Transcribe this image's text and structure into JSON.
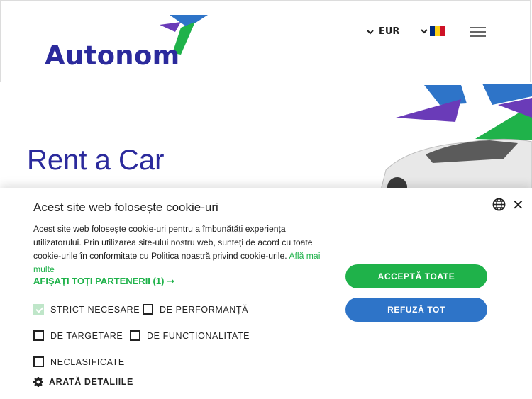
{
  "header": {
    "logo_text": "Autonom",
    "currency": "EUR",
    "flag_colors": [
      "#002b7f",
      "#fcd116",
      "#ce1126"
    ],
    "icons": [
      "logo-mark-icon",
      "chevron-down-icon",
      "romania-flag-icon",
      "hamburger-menu-icon"
    ]
  },
  "hero": {
    "title": "Rent a Car"
  },
  "cookie_banner": {
    "title": "Acest site web folosește cookie-uri",
    "text": "Acest site web folosește cookie-uri pentru a îmbunătăți experiența utilizatorului. Prin utilizarea site-ului nostru web, sunteți de acord cu toate cookie-urile în conformitate cu Politica noastră privind cookie-urile.",
    "learn_more": "Află mai multe",
    "partners_link": "AFIȘAȚI TOȚI PARTENERII (1) ➝",
    "accept_all": "ACCEPTĂ TOATE",
    "reject_all": "REFUZĂ TOT",
    "close_symbol": "✕",
    "categories": [
      {
        "label": "STRICT NECESARE",
        "checked": true
      },
      {
        "label": "DE PERFORMANȚĂ",
        "checked": false
      },
      {
        "label": "DE TARGETARE",
        "checked": false
      },
      {
        "label": "DE FUNCȚIONALITATE",
        "checked": false
      },
      {
        "label": "NECLASIFICATE",
        "checked": false
      }
    ],
    "show_details": "ARATĂ DETALIILE"
  },
  "colors": {
    "brand_blue": "#2b2a9c",
    "accept_green": "#1fb24a",
    "reject_blue": "#2e74c8"
  }
}
